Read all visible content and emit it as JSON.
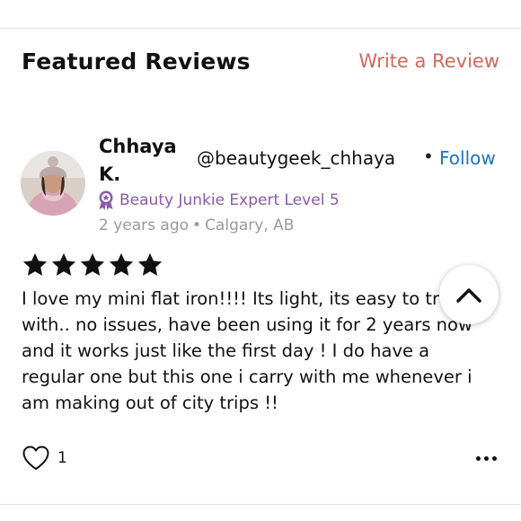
{
  "header": {
    "title": "Featured Reviews",
    "write_review_label": "Write a Review"
  },
  "review": {
    "reviewer_name": "Chhaya K.",
    "handle": "@beautygeek_chhaya",
    "follow_label": "Follow",
    "badge": "Beauty Junkie Expert Level 5",
    "time_ago": "2 years ago",
    "location": "Calgary, AB",
    "rating": 5,
    "max_rating": 5,
    "text": "I love my mini flat iron!!!! Its light, its easy to travel with.. no issues, have been using it for 2 years now and it works just like the first day ! I do have a regular one but this one i carry with me whenever i am making out of city trips !!",
    "like_count": "1"
  },
  "colors": {
    "accent_link": "#d2685d",
    "follow": "#1b73c9",
    "badge": "#8c5aa8",
    "meta": "#9a9a9a"
  },
  "icons": {
    "badge": "award-ribbon-icon",
    "star": "star-icon",
    "like": "heart-outline-icon",
    "more": "more-dots-icon",
    "scroll_top": "chevron-up-icon"
  }
}
